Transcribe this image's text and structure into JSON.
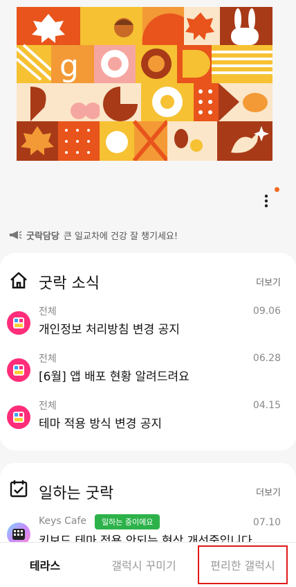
{
  "notice": {
    "author": "굿락담당",
    "message": "큰 일교차에 건강 잘 챙기세요!"
  },
  "news_section": {
    "title": "굿락 소식",
    "more_label": "더보기",
    "items": [
      {
        "category": "전체",
        "title": "개인정보 처리방침 변경 공지",
        "date": "09.06"
      },
      {
        "category": "전체",
        "title": "[6월] 앱 배포 현황 알려드려요",
        "date": "06.28"
      },
      {
        "category": "전체",
        "title": "테마 적용 방식 변경 공지",
        "date": "04.15"
      }
    ]
  },
  "work_section": {
    "title": "일하는 굿락",
    "more_label": "더보기",
    "items": [
      {
        "category": "Keys Cafe",
        "badge": "일하는 중이에요",
        "title": "키보드 테마 적용 안되는 현상 개선중입니다",
        "date": "07.10"
      }
    ]
  },
  "bottom_tabs": [
    {
      "label": "테라스",
      "active": true
    },
    {
      "label": "갤럭시 꾸미기",
      "active": false
    },
    {
      "label": "편리한 갤럭시",
      "active": false,
      "highlighted": true
    }
  ],
  "colors": {
    "accent_orange": "#f26a1f",
    "badge_green": "#2db24a",
    "highlight_red": "#e01818"
  }
}
